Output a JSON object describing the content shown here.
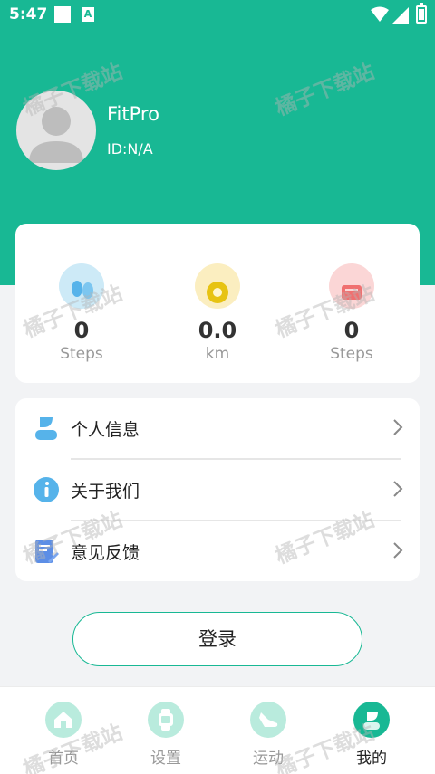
{
  "status_bar": {
    "time": "5:47",
    "notification_letter": "A"
  },
  "colors": {
    "brand": "#18b894",
    "steps_icon": "#cdeaf7",
    "distance_icon": "#fbeec0",
    "calorie_icon": "#fbd6d6"
  },
  "profile": {
    "name": "FitPro",
    "id_text": "ID:N/A",
    "avatar_icon": "person-silhouette"
  },
  "stats": [
    {
      "value": "0",
      "unit": "Steps",
      "icon": "footprints-icon"
    },
    {
      "value": "0.0",
      "unit": "km",
      "icon": "location-icon"
    },
    {
      "value": "0",
      "unit": "Steps",
      "icon": "flame-icon"
    }
  ],
  "menu": [
    {
      "label": "个人信息",
      "icon": "user-icon"
    },
    {
      "label": "关于我们",
      "icon": "info-icon"
    },
    {
      "label": "意见反馈",
      "icon": "feedback-icon"
    }
  ],
  "login": {
    "label": "登录"
  },
  "bottom_nav": [
    {
      "label": "首页",
      "icon": "home-icon",
      "active": false
    },
    {
      "label": "设置",
      "icon": "watch-icon",
      "active": false
    },
    {
      "label": "运动",
      "icon": "shoe-icon",
      "active": false
    },
    {
      "label": "我的",
      "icon": "profile-icon",
      "active": true
    }
  ],
  "watermark": {
    "text": "橘子下载站"
  }
}
